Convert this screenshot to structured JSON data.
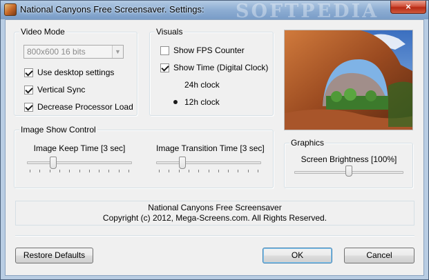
{
  "window": {
    "title": "National Canyons Free Screensaver. Settings:",
    "watermark": "SOFTPEDIA",
    "close_glyph": "×"
  },
  "video_mode": {
    "legend": "Video Mode",
    "resolution_value": "800x600 16 bits",
    "use_desktop_settings": {
      "label": "Use desktop settings",
      "checked": true
    },
    "vertical_sync": {
      "label": "Vertical Sync",
      "checked": true
    },
    "decrease_processor_load": {
      "label": "Decrease Processor Load",
      "checked": true
    }
  },
  "visuals": {
    "legend": "Visuals",
    "show_fps_counter": {
      "label": "Show FPS Counter",
      "checked": false
    },
    "show_time": {
      "label": "Show Time (Digital Clock)",
      "checked": true
    },
    "clock_24h": {
      "label": "24h clock",
      "selected": false
    },
    "clock_12h": {
      "label": "12h clock",
      "selected": true
    }
  },
  "image_show_control": {
    "legend": "Image Show Control",
    "keep_time": {
      "label": "Image Keep Time [3 sec]",
      "fraction": 0.23
    },
    "transition_time": {
      "label": "Image Transition Time [3 sec]",
      "fraction": 0.23
    }
  },
  "graphics": {
    "legend": "Graphics",
    "brightness": {
      "label": "Screen Brightness [100%]",
      "fraction": 0.5
    }
  },
  "info": {
    "line1": "National Canyons Free Screensaver",
    "line2": "Copyright (c) 2012, Mega-Screens.com. All Rights Reserved."
  },
  "buttons": {
    "restore_defaults": "Restore Defaults",
    "ok": "OK",
    "cancel": "Cancel"
  },
  "colors": {
    "title_gradient_top": "#b4cbe4",
    "close_button": "#c83a22",
    "dialog_background": "#f0f0f0",
    "default_button_border": "#3c7fb1"
  }
}
